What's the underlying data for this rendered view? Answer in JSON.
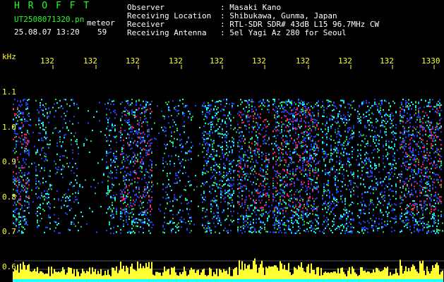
{
  "header": {
    "title": "H R O F F T",
    "filename": "UT2508071320.pn",
    "mode": "meteor",
    "datetime": "25.08.07 13:20",
    "count": "59",
    "observer_label": "Observer",
    "observer_value": ": Masaki Kano",
    "location_label": "Receiving Location",
    "location_value": ": Shibukawa, Gunma, Japan",
    "receiver_label": "Receiver",
    "receiver_value": ": RTL-SDR SDR# 43dB L15 96.7MHz CW",
    "antenna_label": "Receiving Antenna",
    "antenna_value": ": 5el Yagi Az 280 for Seoul"
  },
  "axis": {
    "unit": "kHz",
    "y_ticks": [
      "1.1",
      "1.0",
      "0.9",
      "0.8",
      "0.7",
      "0.6"
    ],
    "x_ticks": [
      "132",
      "132",
      "132",
      "132",
      "132",
      "132",
      "132",
      "132",
      "132",
      "1330"
    ]
  },
  "colors": {
    "text_green": "#22ff22",
    "text_white": "#ffffff",
    "text_yellow": "#ffff33",
    "intense": "#ff2266",
    "signal_blue": "#2244ff",
    "signal_cyan": "#22ffff",
    "signal_green": "#33dd33"
  }
}
